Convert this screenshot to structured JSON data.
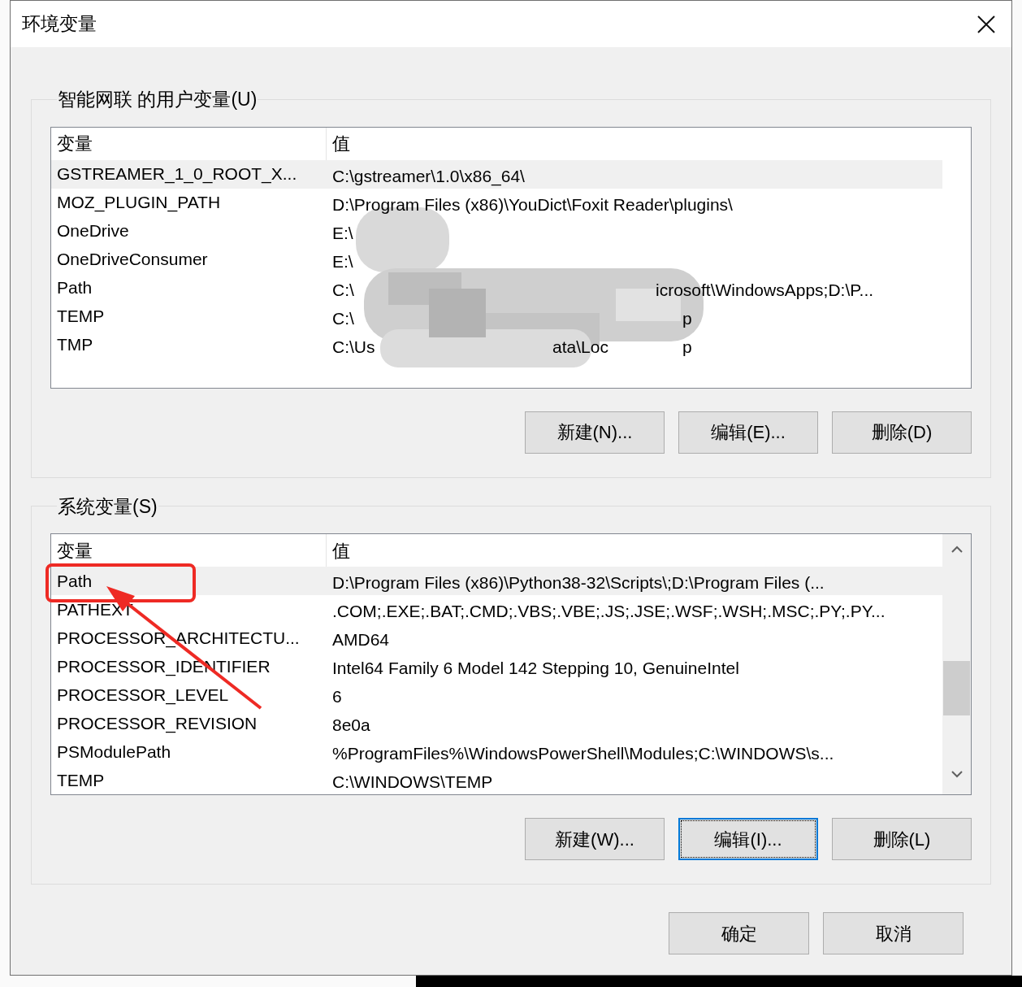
{
  "window": {
    "title": "环境变量"
  },
  "user_variables": {
    "title": "智能网联 的用户变量(U)",
    "columns": [
      "变量",
      "值"
    ],
    "rows": [
      {
        "name": "GSTREAMER_1_0_ROOT_X...",
        "value": [
          "C:\\gstreamer\\1.0\\x86_64\\"
        ],
        "selected": true
      },
      {
        "name": "MOZ_PLUGIN_PATH",
        "value": [
          "D:\\Program Files (x86)\\YouDict\\Foxit Reader\\plugins\\"
        ],
        "selected": false
      },
      {
        "name": "OneDrive",
        "value": [
          "E:\\"
        ],
        "selected": false
      },
      {
        "name": "OneDriveConsumer",
        "value": [
          "E:\\"
        ],
        "selected": false
      },
      {
        "name": "Path",
        "value": [
          "C:\\",
          "icrosoft\\WindowsApps;D:\\P..."
        ],
        "selected": false
      },
      {
        "name": "TEMP",
        "value": [
          "C:\\",
          "p"
        ],
        "selected": false
      },
      {
        "name": "TMP",
        "value": [
          "C:\\Us",
          "ata\\Loc",
          "p"
        ],
        "selected": false
      }
    ],
    "buttons": [
      {
        "label": "新建(N)...",
        "focused": false
      },
      {
        "label": "编辑(E)...",
        "focused": false
      },
      {
        "label": "删除(D)",
        "focused": false
      }
    ]
  },
  "system_variables": {
    "title": "系统变量(S)",
    "columns": [
      "变量",
      "值"
    ],
    "rows": [
      {
        "name": "Path",
        "value": [
          "D:\\Program Files (x86)\\Python38-32\\Scripts\\;D:\\Program Files (..."
        ],
        "selected": true
      },
      {
        "name": "PATHEXT",
        "value": [
          ".COM;.EXE;.BAT;.CMD;.VBS;.VBE;.JS;.JSE;.WSF;.WSH;.MSC;.PY;.PY..."
        ],
        "selected": false
      },
      {
        "name": "PROCESSOR_ARCHITECTU...",
        "value": [
          "AMD64"
        ],
        "selected": false
      },
      {
        "name": "PROCESSOR_IDENTIFIER",
        "value": [
          "Intel64 Family 6 Model 142 Stepping 10, GenuineIntel"
        ],
        "selected": false
      },
      {
        "name": "PROCESSOR_LEVEL",
        "value": [
          "6"
        ],
        "selected": false
      },
      {
        "name": "PROCESSOR_REVISION",
        "value": [
          "8e0a"
        ],
        "selected": false
      },
      {
        "name": "PSModulePath",
        "value": [
          "%ProgramFiles%\\WindowsPowerShell\\Modules;C:\\WINDOWS\\s..."
        ],
        "selected": false
      },
      {
        "name": "TEMP",
        "value": [
          "C:\\WINDOWS\\TEMP"
        ],
        "selected": false
      }
    ],
    "buttons": [
      {
        "label": "新建(W)...",
        "focused": false
      },
      {
        "label": "编辑(I)...",
        "focused": true
      },
      {
        "label": "删除(L)",
        "focused": false
      }
    ]
  },
  "footer_buttons": [
    "确定",
    "取消"
  ]
}
